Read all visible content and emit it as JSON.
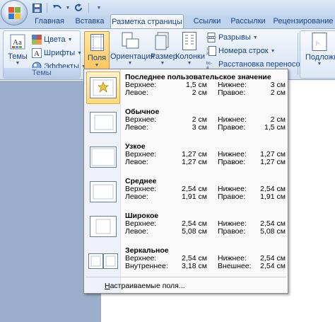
{
  "qat": {
    "save": "save-icon",
    "undo": "undo-icon",
    "redo": "redo-icon",
    "more": "customize-icon"
  },
  "tabs": [
    {
      "label": "Главная"
    },
    {
      "label": "Вставка"
    },
    {
      "label": "Разметка страницы",
      "active": true
    },
    {
      "label": "Ссылки"
    },
    {
      "label": "Рассылки"
    },
    {
      "label": "Рецензирование"
    }
  ],
  "ribbon": {
    "themes_group": {
      "label": "Темы",
      "themes_button": "Темы",
      "colors": "Цвета",
      "fonts": "Шрифты",
      "effects": "Эффекты"
    },
    "margins_button": "Поля",
    "orientation_button": "Ориентация",
    "size_button": "Размер",
    "columns_button": "Колонки",
    "breaks": "Разрывы",
    "line_numbers": "Номера строк",
    "hyphenation": "Расстановка переносов",
    "right_group_button": "Подложк"
  },
  "margins_menu": {
    "options": [
      {
        "name": "Последнее пользовательское значение",
        "labels": [
          "Верхнее:",
          "Левое:",
          "Нижнее:",
          "Правое:"
        ],
        "values": [
          "1,5 см",
          "2 см",
          "3 см",
          "2 см"
        ],
        "selected": true
      },
      {
        "name": "Обычное",
        "labels": [
          "Верхнее:",
          "Левое:",
          "Нижнее:",
          "Правое:"
        ],
        "values": [
          "2 см",
          "3 см",
          "2 см",
          "1,5 см"
        ]
      },
      {
        "name": "Узкое",
        "labels": [
          "Верхнее:",
          "Левое:",
          "Нижнее:",
          "Правое:"
        ],
        "values": [
          "1,27 см",
          "1,27 см",
          "1,27 см",
          "1,27 см"
        ]
      },
      {
        "name": "Среднее",
        "labels": [
          "Верхнее:",
          "Левое:",
          "Нижнее:",
          "Правое:"
        ],
        "values": [
          "2,54 см",
          "1,91 см",
          "2,54 см",
          "1,91 см"
        ]
      },
      {
        "name": "Широкое",
        "labels": [
          "Верхнее:",
          "Левое:",
          "Нижнее:",
          "Правое:"
        ],
        "values": [
          "2,54 см",
          "5,08 см",
          "2,54 см",
          "5,08 см"
        ]
      },
      {
        "name": "Зеркальное",
        "labels": [
          "Верхнее:",
          "Внутреннее:",
          "Нижнее:",
          "Внешнее:"
        ],
        "values": [
          "2,54 см",
          "3,18 см",
          "2,54 см",
          "2,54 см"
        ]
      }
    ],
    "custom_prefix": "Н",
    "custom_rest": "астраиваемые поля..."
  }
}
